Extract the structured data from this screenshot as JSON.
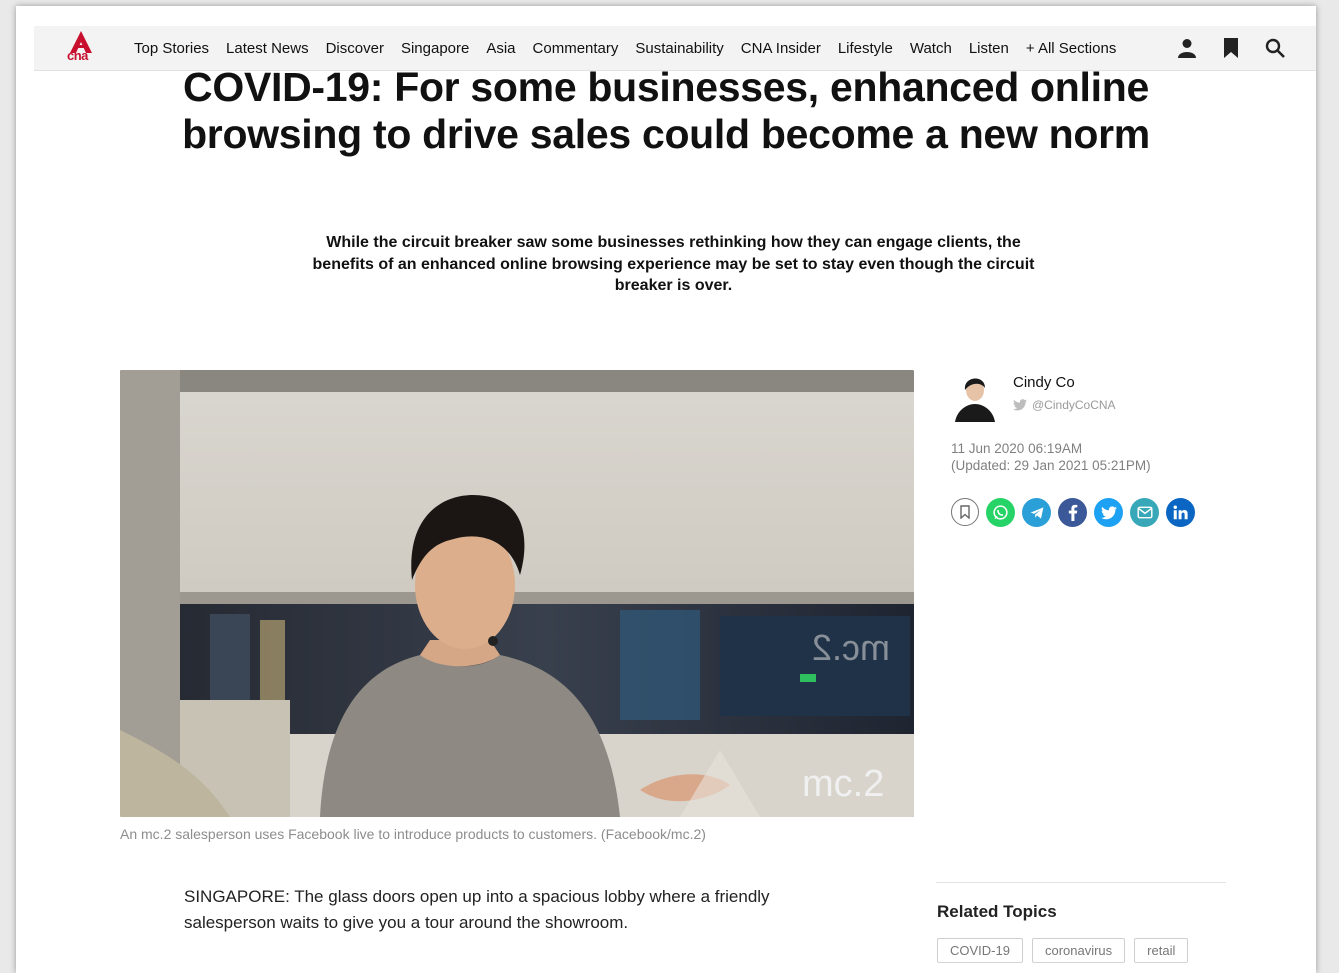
{
  "nav": {
    "logo_text": "cna",
    "items": [
      {
        "label": "Top Stories"
      },
      {
        "label": "Latest News"
      },
      {
        "label": "Discover"
      },
      {
        "label": "Singapore"
      },
      {
        "label": "Asia"
      },
      {
        "label": "Commentary"
      },
      {
        "label": "Sustainability"
      },
      {
        "label": "CNA Insider"
      },
      {
        "label": "Lifestyle"
      },
      {
        "label": "Watch"
      },
      {
        "label": "Listen"
      },
      {
        "label": "+ All Sections"
      }
    ],
    "icons": [
      "user-icon",
      "bookmark-icon",
      "search-icon"
    ]
  },
  "article": {
    "headline": "COVID-19: For some businesses, enhanced online browsing to drive sales could become a new norm",
    "standfirst": "While the circuit breaker saw some businesses rethinking how they can engage clients, the benefits of an enhanced online browsing experience may be set to stay even though the circuit breaker is over.",
    "image_caption": "An mc.2 salesperson uses Facebook live to introduce products to customers. (Facebook/mc.2)",
    "image_sign_text": "mc.2",
    "body": "SINGAPORE: The glass doors open up into a spacious lobby where a friendly salesperson waits to give you a tour around the showroom."
  },
  "byline": {
    "author": "Cindy Co",
    "handle": "@CindyCoCNA",
    "published": "11 Jun 2020 06:19AM",
    "updated": "(Updated: 29 Jan 2021 05:21PM)"
  },
  "share": [
    {
      "name": "bookmark",
      "color": "#ffffff"
    },
    {
      "name": "whatsapp",
      "color": "#25d366"
    },
    {
      "name": "telegram",
      "color": "#2a9fd8"
    },
    {
      "name": "facebook",
      "color": "#3b5998"
    },
    {
      "name": "twitter",
      "color": "#1da1f2"
    },
    {
      "name": "email",
      "color": "#38a8b8"
    },
    {
      "name": "linkedin",
      "color": "#0a66c2"
    }
  ],
  "related": {
    "title": "Related Topics",
    "tags": [
      "COVID-19",
      "coronavirus",
      "retail"
    ]
  },
  "colors": {
    "brand_red": "#c8102e",
    "nav_bg": "#f3f3f3"
  }
}
